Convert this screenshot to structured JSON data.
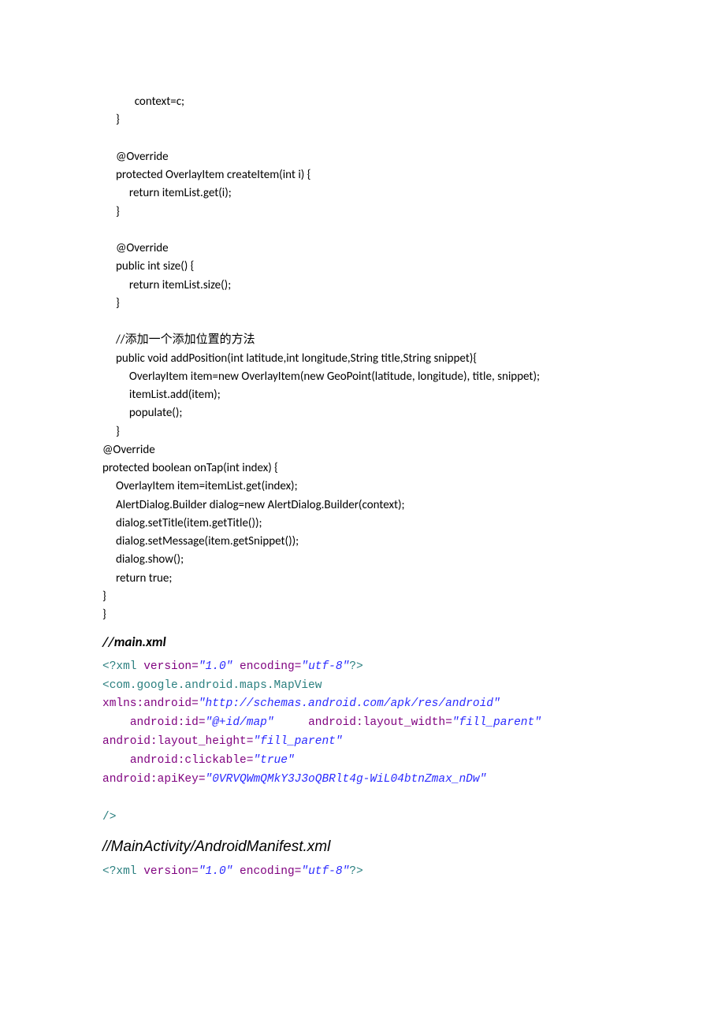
{
  "java": {
    "l1": "            context=c;",
    "l2": "     }",
    "l3": "",
    "l4": "     @Override",
    "l5": "     protected OverlayItem createItem(int i) {",
    "l6": "          return itemList.get(i);",
    "l7": "     }",
    "l8": "",
    "l9": "     @Override",
    "l10": "     public int size() {",
    "l11": "          return itemList.size();",
    "l12": "     }",
    "l13": "",
    "l14a": "     //",
    "l14b": "添加一个添加位置的方法",
    "l15": "     public void addPosition(int latitude,int longitude,String title,String snippet){",
    "l16": "          OverlayItem item=new OverlayItem(new GeoPoint(latitude, longitude), title, snippet);",
    "l17": "          itemList.add(item);",
    "l18": "          populate();",
    "l19": "     }",
    "l20": "@Override",
    "l21": "protected boolean onTap(int index) {",
    "l22": "     OverlayItem item=itemList.get(index);",
    "l23": "     AlertDialog.Builder dialog=new AlertDialog.Builder(context);",
    "l24": "     dialog.setTitle(item.getTitle());",
    "l25": "     dialog.setMessage(item.getSnippet());",
    "l26": "     dialog.show();",
    "l27": "     return true;",
    "l28": "}",
    "l29": "}"
  },
  "heading1": "//main.xml",
  "xml1": {
    "pi_open": "<?",
    "pi_xml": "xml",
    "attr_version": " version=",
    "val_version": "\"1.0\"",
    "attr_encoding": " encoding=",
    "val_encoding": "\"utf-8\"",
    "pi_close": "?>",
    "tag_open": "<",
    "tag_name": "com.google.android.maps.MapView",
    "attr_xmlns": "xmlns:android=",
    "val_xmlns": "\"http://schemas.android.com/apk/res/android\"",
    "indent": "    ",
    "attr_id": "android:id=",
    "val_id": "\"@+id/map\"",
    "spaces_after_id": "     ",
    "attr_width": "android:layout_width=",
    "val_width": "\"fill_parent\"",
    "attr_height": "android:layout_height=",
    "val_height": "\"fill_parent\"",
    "attr_clickable": "android:clickable=",
    "val_clickable": "\"true\"",
    "attr_apikey": "android:apiKey=",
    "val_apikey": "\"0VRVQWmQMkY3J3oQBRlt4g-WiL04btnZmax_nDw\"",
    "tag_close": "/>"
  },
  "heading2": "//MainActivity/AndroidManifest.xml",
  "xml2": {
    "pi_open": "<?",
    "pi_xml": "xml",
    "attr_version": " version=",
    "val_version": "\"1.0\"",
    "attr_encoding": " encoding=",
    "val_encoding": "\"utf-8\"",
    "pi_close": "?>"
  }
}
